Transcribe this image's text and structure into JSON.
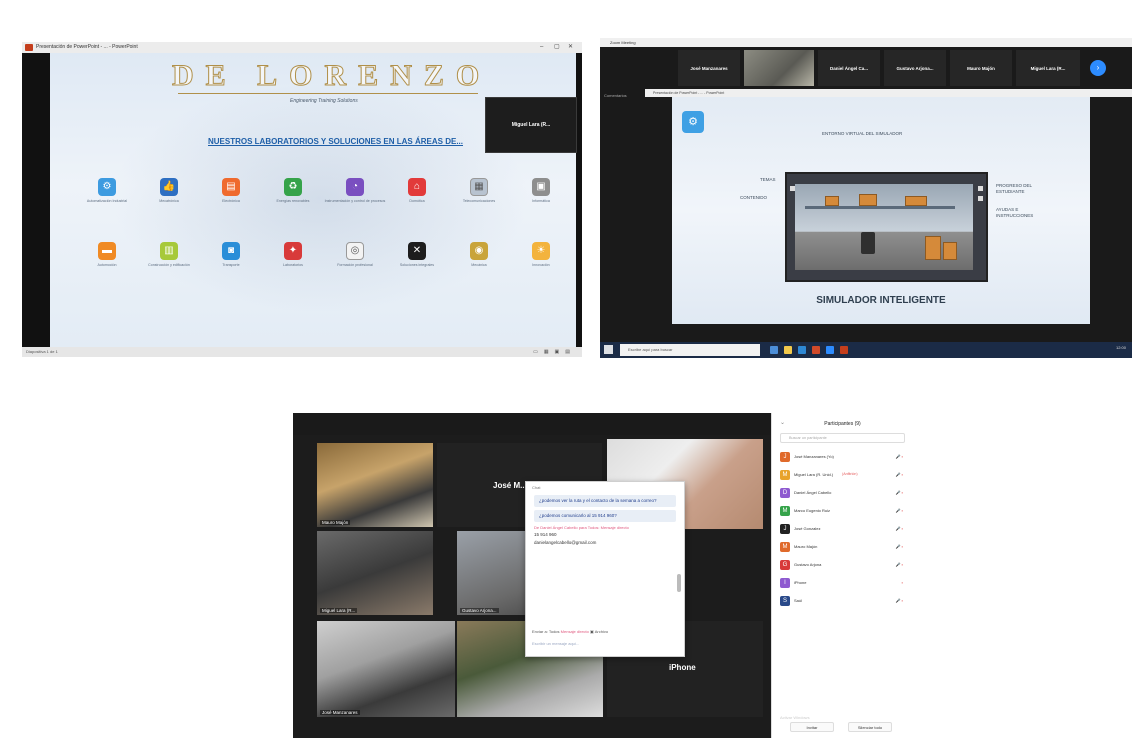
{
  "shot1": {
    "window_title": "Presentación de PowerPoint - ... - PowerPoint",
    "brand": "DE LORENZO",
    "tagline": "Engineering Training Solutions",
    "heading": "NUESTROS LABORATORIOS Y SOLUCIONES EN LAS ÁREAS DE...",
    "speaker": "Miguel Lara (R...",
    "status": "Diapositiva 1 de 1",
    "icons_row1": [
      {
        "icon": "gears-icon",
        "color": "#3d9be0",
        "glyph": "⚙",
        "caption": "Automatización Industrial"
      },
      {
        "icon": "thumbs-up-icon",
        "color": "#2e6fc2",
        "glyph": "👍",
        "caption": "Mecatrónica"
      },
      {
        "icon": "slides-icon",
        "color": "#ef6a2e",
        "glyph": "▤",
        "caption": "Electrónica"
      },
      {
        "icon": "recycle-icon",
        "color": "#35a34a",
        "glyph": "♻",
        "caption": "Energías renovables"
      },
      {
        "icon": "gauge-icon",
        "color": "#7a4fc0",
        "glyph": "◔",
        "caption": "Instrumentación y control de procesos"
      },
      {
        "icon": "house-icon",
        "color": "#e23a3a",
        "glyph": "⌂",
        "caption": "Domótica"
      },
      {
        "icon": "chart-icon",
        "color": "#b8c3d0",
        "glyph": "▦",
        "caption": "Telecomunicaciones"
      },
      {
        "icon": "screen-icon",
        "color": "#8e8e8e",
        "glyph": "▣",
        "caption": "Informática"
      }
    ],
    "icons_row2": [
      {
        "icon": "truck-icon",
        "color": "#f08a24",
        "glyph": "▬",
        "caption": "Automoción"
      },
      {
        "icon": "building-icon",
        "color": "#a7c93a",
        "glyph": "▥",
        "caption": "Construcción y edificación"
      },
      {
        "icon": "bus-icon",
        "color": "#2a8ed8",
        "glyph": "◙",
        "caption": "Transporte"
      },
      {
        "icon": "handshake-icon",
        "color": "#d83a3a",
        "glyph": "✦",
        "caption": "Laboratorios"
      },
      {
        "icon": "target-icon",
        "color": "#f3f3f3",
        "glyph": "◎",
        "caption": "Formación profesional"
      },
      {
        "icon": "pin-icon",
        "color": "#1d1d1d",
        "glyph": "✕",
        "caption": "Soluciones integrales"
      },
      {
        "icon": "gear-tile-icon",
        "color": "#c9a43a",
        "glyph": "◉",
        "caption": "Mecánica"
      },
      {
        "icon": "bulb-icon",
        "color": "#f3b33d",
        "glyph": "☀",
        "caption": "Innovación"
      }
    ]
  },
  "shot2": {
    "window_title": "Zoom Meeting",
    "participants": [
      "José Manzanares",
      "Daniel Ángel Ca...",
      "Gustavo Arjona...",
      "Mauro Majón",
      "Miguel Lara (R..."
    ],
    "sidebar_label": "Comentarios",
    "ppt_title": "Presentación de PowerPoint - ... - PowerPoint",
    "slide_header": "ENTORNO VIRTUAL DEL SIMULADOR",
    "left_labels": [
      "TEMAS",
      "CONTENIDO"
    ],
    "right_labels": [
      "PROGRESO DEL ESTUDIANTE",
      "AYUDAS E INSTRUCCIONES"
    ],
    "slide_footer": "SIMULADOR INTELIGENTE",
    "search_placeholder": "Escribe aquí para buscar",
    "clock": "12:00"
  },
  "shot3": {
    "top_name": "José M...",
    "iphone": "iPhone",
    "video_names": [
      "Mauro Majón",
      "Miguel Lara (R...",
      "Gustavo Arjona...",
      "José Manzanares",
      "iPhone"
    ],
    "chat": {
      "header": "Chat",
      "msg1": "¿podemos ver la ruta y el contacto de la semana a correo?",
      "msg2": "¿podemos comunicarlo al 15 914 960?",
      "sender": "De Daniel Ángel Cabello para Todos: Mensaje directo",
      "plain1": "15 914 960",
      "plain2": "danielangelcabello@gmail.com",
      "to_label": "Enviar a:",
      "to_value": "Todos",
      "direct": "Mensaje directo",
      "archive": "Archivo",
      "input_placeholder": "Escribir un mensaje aquí..."
    },
    "participants": {
      "title": "Participantes (9)",
      "search": "Buscar un participante",
      "list": [
        {
          "initial": "J",
          "color": "#e06a2b",
          "name": "José Manzanares (Yo)",
          "role": "",
          "icons": "🎤 ▪"
        },
        {
          "initial": "M",
          "color": "#e8a32b",
          "name": "Miguel Lara (R. Unid.)",
          "role": "(Anfitrión)",
          "icons": "🎤 ▪"
        },
        {
          "initial": "D",
          "color": "#8e5ad0",
          "name": "Daniel Ángel Cabello",
          "role": "",
          "icons": "🎤 ▪"
        },
        {
          "initial": "M",
          "color": "#35a34a",
          "name": "Marco Eugenio Ruiz",
          "role": "",
          "icons": "🎤 ▪"
        },
        {
          "initial": "J",
          "color": "#222222",
          "name": "José Gonzalez",
          "role": "",
          "icons": "🎤 ▪"
        },
        {
          "initial": "M",
          "color": "#e06a2b",
          "name": "Mauro Majón",
          "role": "",
          "icons": "🎤 ▪"
        },
        {
          "initial": "G",
          "color": "#d83a3a",
          "name": "Gustavo Arjona",
          "role": "",
          "icons": "🎤 ▪"
        },
        {
          "initial": "I",
          "color": "#8e5ad0",
          "name": "iPhone",
          "role": "",
          "icons": "▪"
        },
        {
          "initial": "S",
          "color": "#2a4a8a",
          "name": "Saúl",
          "role": "",
          "icons": "🎤 ▪"
        }
      ],
      "invite": "Invitar",
      "mute_all": "Silenciar todo",
      "faint": "Activar Windows"
    }
  }
}
